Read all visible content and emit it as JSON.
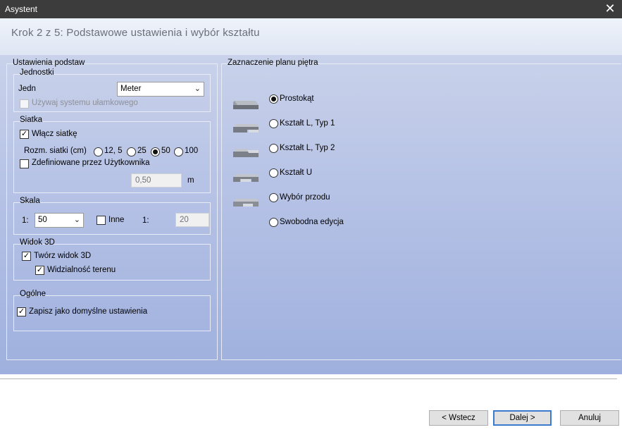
{
  "window": {
    "title": "Asystent",
    "close_icon": "close-icon"
  },
  "header": {
    "step": "Krok 2 z 5:  Podstawowe ustawienia i wybór kształtu"
  },
  "left_panel": {
    "title": "Ustawienia podstaw",
    "units": {
      "title": "Jednostki",
      "unit_label": "Jedn",
      "unit_value": "Meter",
      "fraction_label": "Używaj systemu ułamkowego",
      "fraction_checked": false
    },
    "grid": {
      "title": "Siatka",
      "enable_label": "Włącz siatkę",
      "enable_checked": true,
      "size_label": "Rozm. siatki (cm)",
      "sizes": [
        "12, 5",
        "25",
        "50",
        "100"
      ],
      "selected_size": "50",
      "user_defined_label": "Zdefiniowane przez Użytkownika",
      "user_defined_checked": false,
      "user_value": "0,50",
      "user_unit": "m"
    },
    "scale": {
      "title": "Skala",
      "prefix": "1:",
      "value": "50",
      "other_label": "Inne",
      "other_checked": false,
      "other_prefix": "1:",
      "other_value": "20"
    },
    "view3d": {
      "title": "Widok 3D",
      "create_label": "Twórz widok 3D",
      "create_checked": true,
      "terrain_label": "Widzialność terenu",
      "terrain_checked": true
    },
    "general": {
      "title": "Ogólne",
      "save_default_label": "Zapisz jako domyślne ustawienia",
      "save_default_checked": true
    }
  },
  "right_panel": {
    "title": "Zaznaczenie planu piętra",
    "options": [
      {
        "label": "Prostokąt",
        "icon": "rectangle-shape-icon"
      },
      {
        "label": "Kształt L, Typ 1",
        "icon": "l-shape-type1-icon"
      },
      {
        "label": "Kształt L, Typ 2",
        "icon": "l-shape-type2-icon"
      },
      {
        "label": "Kształt U",
        "icon": "u-shape-icon"
      },
      {
        "label": "Wybór przodu",
        "icon": "front-selection-icon"
      },
      {
        "label": "Swobodna edycja",
        "icon": ""
      }
    ],
    "selected_index": 0
  },
  "footer": {
    "back_label": "< Wstecz",
    "next_label": "Dalej >",
    "cancel_label": "Anuluj"
  }
}
